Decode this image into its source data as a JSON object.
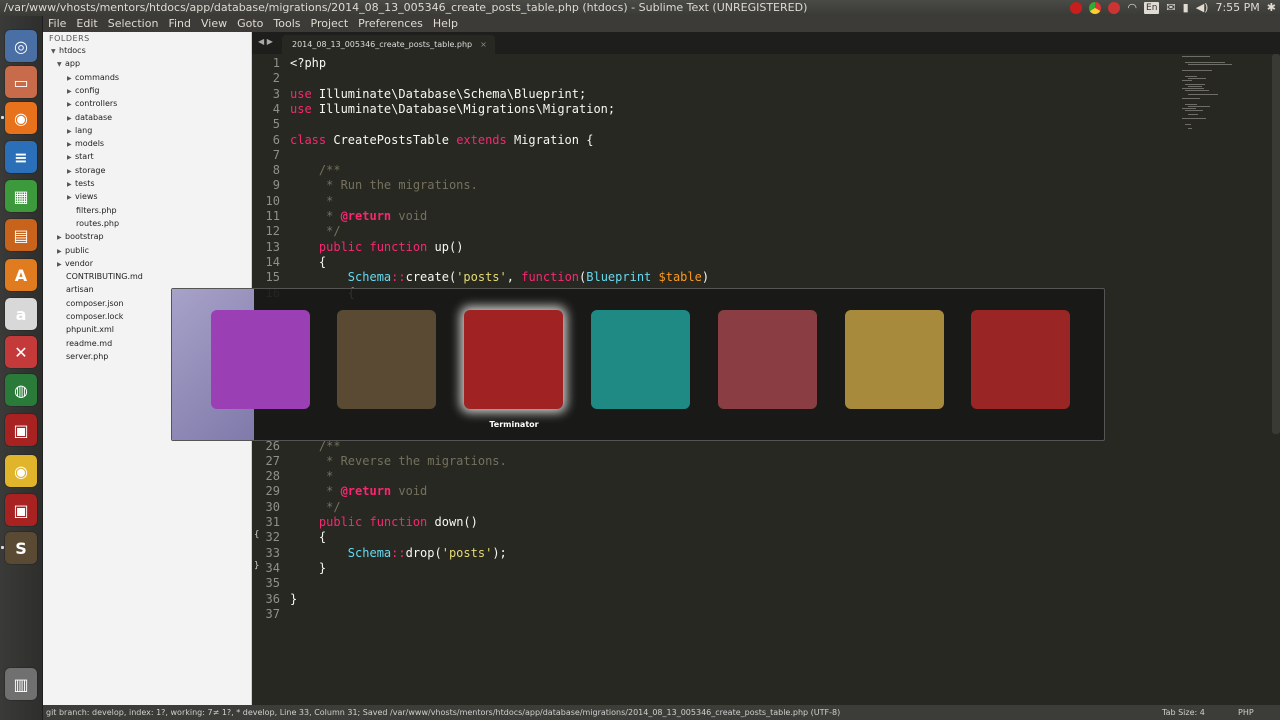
{
  "window": {
    "title": "/var/www/vhosts/mentors/htdocs/app/database/migrations/2014_08_13_005346_create_posts_table.php (htdocs) - Sublime Text (UNREGISTERED)",
    "clock": "7:55 PM",
    "keyboard_layout": "En"
  },
  "menu": [
    "File",
    "Edit",
    "Selection",
    "Find",
    "View",
    "Goto",
    "Tools",
    "Project",
    "Preferences",
    "Help"
  ],
  "sidebar": {
    "header": "FOLDERS",
    "tree": [
      {
        "label": "htdocs",
        "depth": 0,
        "arrow": "open"
      },
      {
        "label": "app",
        "depth": 1,
        "arrow": "open"
      },
      {
        "label": "commands",
        "depth": 2,
        "arrow": "closed"
      },
      {
        "label": "config",
        "depth": 2,
        "arrow": "closed"
      },
      {
        "label": "controllers",
        "depth": 2,
        "arrow": "closed"
      },
      {
        "label": "database",
        "depth": 2,
        "arrow": "closed"
      },
      {
        "label": "lang",
        "depth": 2,
        "arrow": "closed"
      },
      {
        "label": "models",
        "depth": 2,
        "arrow": "closed"
      },
      {
        "label": "start",
        "depth": 2,
        "arrow": "closed"
      },
      {
        "label": "storage",
        "depth": 2,
        "arrow": "closed"
      },
      {
        "label": "tests",
        "depth": 2,
        "arrow": "closed"
      },
      {
        "label": "views",
        "depth": 2,
        "arrow": "closed"
      },
      {
        "label": "filters.php",
        "depth": 2,
        "arrow": "none"
      },
      {
        "label": "routes.php",
        "depth": 2,
        "arrow": "none"
      },
      {
        "label": "bootstrap",
        "depth": 1,
        "arrow": "closed"
      },
      {
        "label": "public",
        "depth": 1,
        "arrow": "closed"
      },
      {
        "label": "vendor",
        "depth": 1,
        "arrow": "closed"
      },
      {
        "label": "CONTRIBUTING.md",
        "depth": 1,
        "arrow": "none"
      },
      {
        "label": "artisan",
        "depth": 1,
        "arrow": "none"
      },
      {
        "label": "composer.json",
        "depth": 1,
        "arrow": "none"
      },
      {
        "label": "composer.lock",
        "depth": 1,
        "arrow": "none"
      },
      {
        "label": "phpunit.xml",
        "depth": 1,
        "arrow": "none"
      },
      {
        "label": "readme.md",
        "depth": 1,
        "arrow": "none"
      },
      {
        "label": "server.php",
        "depth": 1,
        "arrow": "none"
      }
    ]
  },
  "tab": {
    "label": "2014_08_13_005346_create_posts_table.php",
    "close": "×"
  },
  "code": [
    {
      "n": "1",
      "parts": [
        [
          "",
          "<?php"
        ]
      ]
    },
    {
      "n": "2",
      "parts": []
    },
    {
      "n": "3",
      "parts": [
        [
          "k",
          "use "
        ],
        [
          "",
          "Illuminate\\Database\\Schema\\Blueprint;"
        ]
      ]
    },
    {
      "n": "4",
      "parts": [
        [
          "k",
          "use "
        ],
        [
          "",
          "Illuminate\\Database\\Migrations\\Migration;"
        ]
      ]
    },
    {
      "n": "5",
      "parts": []
    },
    {
      "n": "6",
      "parts": [
        [
          "k",
          "class "
        ],
        [
          "",
          "CreatePostsTable "
        ],
        [
          "k",
          "extends "
        ],
        [
          "",
          "Migration {"
        ]
      ]
    },
    {
      "n": "7",
      "parts": []
    },
    {
      "n": "8",
      "parts": [
        [
          "c",
          "    /**"
        ]
      ]
    },
    {
      "n": "9",
      "parts": [
        [
          "c",
          "     * Run the migrations."
        ]
      ]
    },
    {
      "n": "10",
      "parts": [
        [
          "c",
          "     *"
        ]
      ]
    },
    {
      "n": "11",
      "parts": [
        [
          "c",
          "     * "
        ],
        [
          "kb",
          "@return"
        ],
        [
          "c",
          " void"
        ]
      ]
    },
    {
      "n": "12",
      "parts": [
        [
          "c",
          "     */"
        ]
      ]
    },
    {
      "n": "13",
      "parts": [
        [
          "",
          "    "
        ],
        [
          "k",
          "public "
        ],
        [
          "k",
          "function "
        ],
        [
          "",
          "up()"
        ]
      ]
    },
    {
      "n": "14",
      "parts": [
        [
          "",
          "    {"
        ]
      ]
    },
    {
      "n": "15",
      "parts": [
        [
          "",
          "        "
        ],
        [
          "t",
          "Schema"
        ],
        [
          "k",
          "::"
        ],
        [
          "",
          "create("
        ],
        [
          "s",
          "'posts'"
        ],
        [
          "",
          ", "
        ],
        [
          "k",
          "function"
        ],
        [
          "",
          "("
        ],
        [
          "t",
          "Blueprint "
        ],
        [
          "p",
          "$table"
        ],
        [
          "",
          ")"
        ]
      ]
    },
    {
      "n": "16",
      "parts": [
        [
          "",
          "        {"
        ]
      ]
    },
    {
      "n": "26",
      "parts": [
        [
          "c",
          "    /**"
        ]
      ]
    },
    {
      "n": "27",
      "parts": [
        [
          "c",
          "     * Reverse the migrations."
        ]
      ]
    },
    {
      "n": "28",
      "parts": [
        [
          "c",
          "     *"
        ]
      ]
    },
    {
      "n": "29",
      "parts": [
        [
          "c",
          "     * "
        ],
        [
          "kb",
          "@return"
        ],
        [
          "c",
          " void"
        ]
      ]
    },
    {
      "n": "30",
      "parts": [
        [
          "c",
          "     */"
        ]
      ]
    },
    {
      "n": "31",
      "parts": [
        [
          "",
          "    "
        ],
        [
          "k",
          "public "
        ],
        [
          "k",
          "function "
        ],
        [
          "",
          "down()"
        ]
      ]
    },
    {
      "n": "32",
      "parts": [
        [
          "",
          "    {"
        ]
      ]
    },
    {
      "n": "33",
      "parts": [
        [
          "",
          "        "
        ],
        [
          "t",
          "Schema"
        ],
        [
          "k",
          "::"
        ],
        [
          "",
          "drop("
        ],
        [
          "s",
          "'posts'"
        ],
        [
          "",
          ");"
        ]
      ]
    },
    {
      "n": "34",
      "parts": [
        [
          "",
          "    }"
        ]
      ]
    },
    {
      "n": "35",
      "parts": []
    },
    {
      "n": "36",
      "parts": [
        [
          "",
          "}"
        ]
      ]
    },
    {
      "n": "37",
      "parts": []
    }
  ],
  "status": {
    "left": "git branch: develop, index: 1?, working: 7≠ 1?, * develop, Line 33, Column 31; Saved /var/www/vhosts/mentors/htdocs/app/database/migrations/2014_08_13_005346_create_posts_table.php (UTF-8)",
    "tab_size": "Tab Size: 4",
    "syntax": "PHP"
  },
  "switcher": {
    "selected_label": "Terminator",
    "apps": [
      {
        "icon": "window-icon",
        "color": "#9b3fb5"
      },
      {
        "icon": "sublime-text-icon",
        "color": "#5a4a34"
      },
      {
        "icon": "terminator-icon",
        "color": "#a02222"
      },
      {
        "icon": "camera-icon",
        "color": "#1f8a84"
      },
      {
        "icon": "file-cabinet-icon",
        "color": "#8a3e44"
      },
      {
        "icon": "chrome-icon",
        "color": "#a88a3d"
      },
      {
        "icon": "terminator-icon",
        "color": "#9a2525"
      }
    ]
  },
  "launcher": [
    {
      "icon": "ubuntu-icon",
      "color": "#4a6fa5",
      "glyph": "◎"
    },
    {
      "icon": "files-icon",
      "color": "#c86b4b",
      "glyph": "▭"
    },
    {
      "icon": "firefox-icon",
      "color": "#e8721c",
      "glyph": "◉"
    },
    {
      "icon": "writer-icon",
      "color": "#2b6fb8",
      "glyph": "≡"
    },
    {
      "icon": "calc-icon",
      "color": "#3c9a3c",
      "glyph": "▦"
    },
    {
      "icon": "impress-icon",
      "color": "#c8631b",
      "glyph": "▤"
    },
    {
      "icon": "software-center-icon",
      "color": "#e07b20",
      "glyph": "A"
    },
    {
      "icon": "amazon-icon",
      "color": "#d8d8d8",
      "glyph": "a"
    },
    {
      "icon": "settings-icon",
      "color": "#c43a3a",
      "glyph": "✕"
    },
    {
      "icon": "globe-icon",
      "color": "#2a7a3a",
      "glyph": "◍"
    },
    {
      "icon": "terminator-icon",
      "color": "#a82222",
      "glyph": "▣"
    },
    {
      "icon": "chrome-icon",
      "color": "#e0b52b",
      "glyph": "◉"
    },
    {
      "icon": "terminator-icon",
      "color": "#a82222",
      "glyph": "▣"
    },
    {
      "icon": "sublime-text-icon",
      "color": "#5a4a34",
      "glyph": "S"
    },
    {
      "icon": "trash-icon",
      "color": "#707070",
      "glyph": "▥"
    }
  ]
}
